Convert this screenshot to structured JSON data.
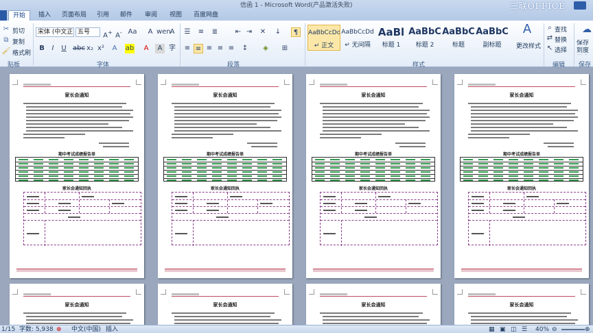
{
  "window": {
    "title": "信函 1 - Microsoft Word(产品激活失败)",
    "brand": "三联OFFICE"
  },
  "tabs": [
    "开始",
    "插入",
    "页面布局",
    "引用",
    "邮件",
    "审阅",
    "视图",
    "百度网盘"
  ],
  "ribbon": {
    "clipboard": {
      "cut": "剪切",
      "copy": "复制",
      "format_painter": "格式刷",
      "group": "贴板"
    },
    "font": {
      "name": "宋体 (中文正)",
      "size": "五号",
      "group": "字体"
    },
    "paragraph": {
      "group": "段落"
    },
    "styles": {
      "group": "样式",
      "items": [
        {
          "sample": "AaBbCcDd",
          "name": "↵ 正文"
        },
        {
          "sample": "AaBbCcDd",
          "name": "↵ 无间隔"
        },
        {
          "sample": "AaBl",
          "name": "标题 1"
        },
        {
          "sample": "AaBbC",
          "name": "标题 2"
        },
        {
          "sample": "AaBbC",
          "name": "标题"
        },
        {
          "sample": "AaBbC",
          "name": "副标题"
        }
      ],
      "change_styles": "更改样式"
    },
    "editing": {
      "find": "查找",
      "replace": "替换",
      "select": "选择",
      "group": "编辑"
    },
    "save": {
      "label": "保存到度网盘",
      "group": "保存"
    }
  },
  "document": {
    "page_title": "家长会通知",
    "table1_title": "期中考试成绩报告单",
    "table2_title": "家长会通知回执",
    "form_labels": [
      "学生姓名",
      "所在班级",
      "家长姓名",
      "与学生关系",
      "联系电话",
      "是否参加",
      "家长签名",
      "家长意见"
    ]
  },
  "status": {
    "page": "1/15",
    "words": "字数: 5,938",
    "lang": "中文(中国)",
    "mode": "插入",
    "zoom": "40%"
  },
  "colors": {
    "accent_red": "#c04a5c",
    "table_green": "#2e9a4b",
    "form_purple": "#8a3d8a",
    "ribbon_blue": "#15428b"
  }
}
